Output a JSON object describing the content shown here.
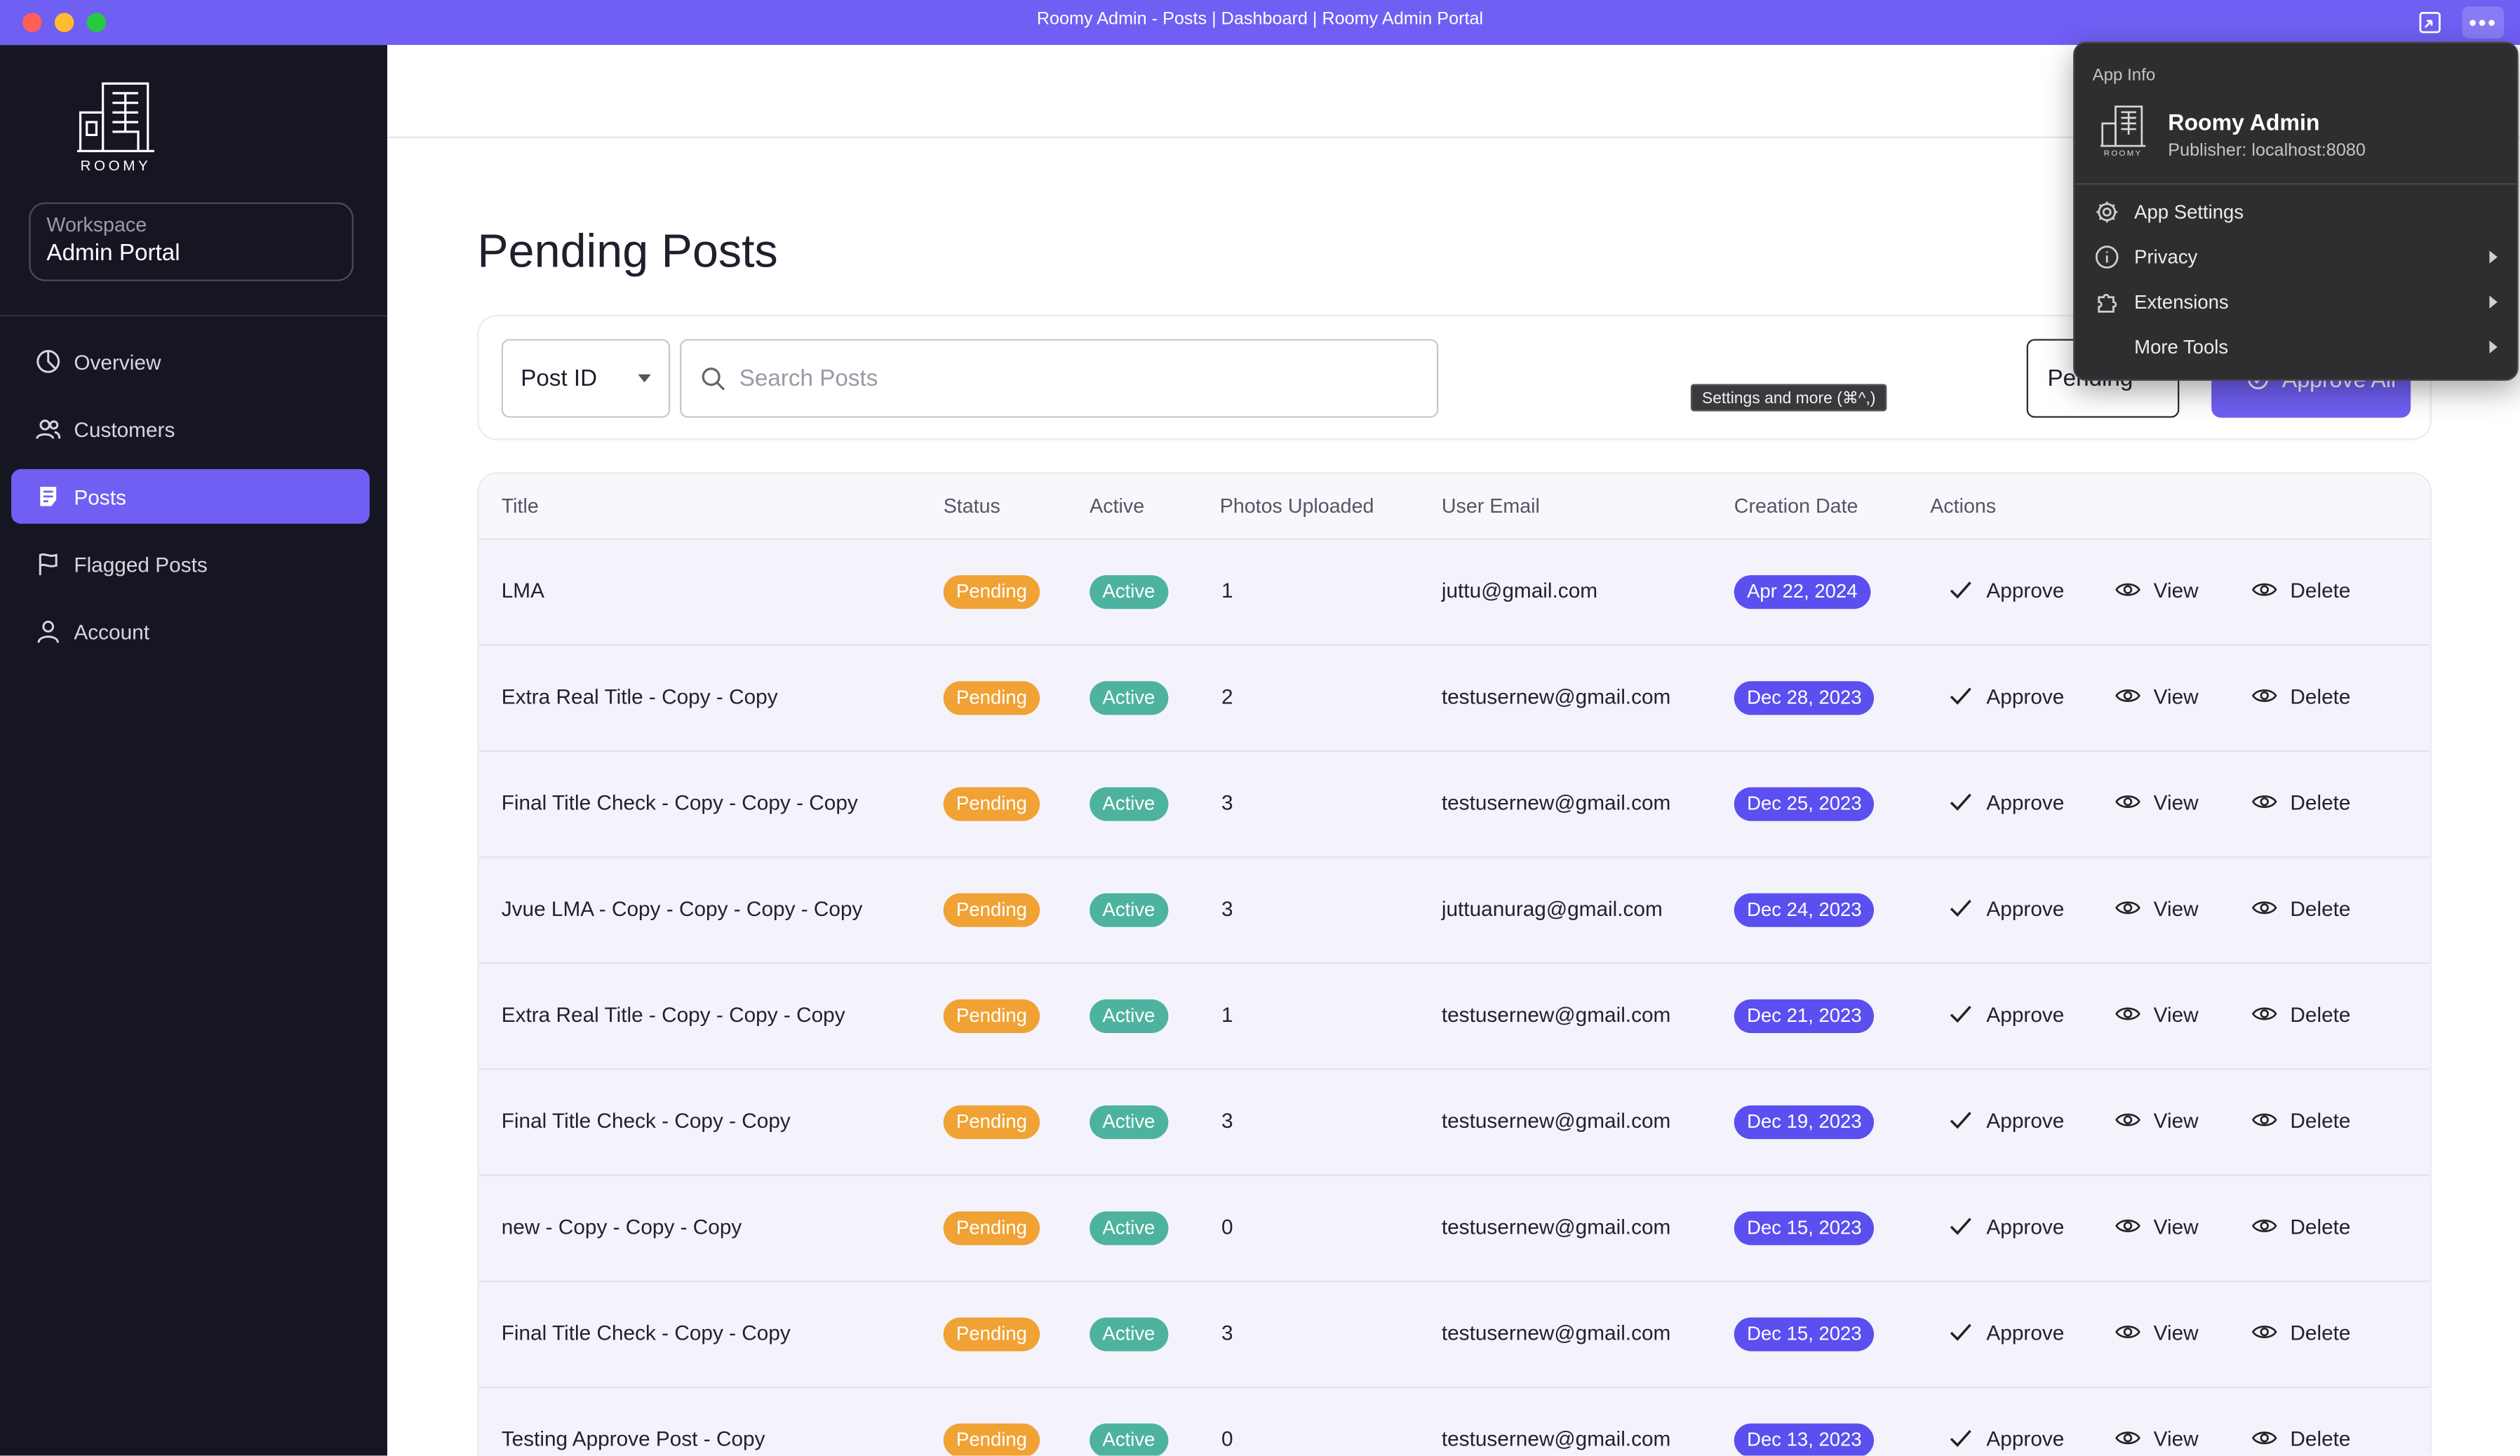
{
  "window": {
    "title": "Roomy Admin - Posts | Dashboard | Roomy Admin Portal"
  },
  "brand": {
    "logo_text": "ROOMY"
  },
  "workspace": {
    "label": "Workspace",
    "value": "Admin Portal"
  },
  "sidebar": {
    "items": [
      {
        "label": "Overview",
        "icon": "chart-pie-icon",
        "active": false
      },
      {
        "label": "Customers",
        "icon": "users-icon",
        "active": false
      },
      {
        "label": "Posts",
        "icon": "post-icon",
        "active": true
      },
      {
        "label": "Flagged Posts",
        "icon": "flag-icon",
        "active": false
      },
      {
        "label": "Account",
        "icon": "user-icon",
        "active": false
      }
    ]
  },
  "page": {
    "title": "Pending Posts"
  },
  "filters": {
    "field_select": "Post ID",
    "search_placeholder": "Search Posts",
    "status_select": "Pending",
    "approve_all": "Approve All"
  },
  "table": {
    "headers": [
      "Title",
      "Status",
      "Active",
      "Photos Uploaded",
      "User Email",
      "Creation Date",
      "Actions"
    ],
    "actions": {
      "approve": "Approve",
      "view": "View",
      "delete": "Delete"
    },
    "rows": [
      {
        "title": "LMA",
        "status": "Pending",
        "active": "Active",
        "photos": "1",
        "email": "juttu@gmail.com",
        "date": "Apr 22, 2024"
      },
      {
        "title": "Extra Real Title - Copy - Copy",
        "status": "Pending",
        "active": "Active",
        "photos": "2",
        "email": "testusernew@gmail.com",
        "date": "Dec 28, 2023"
      },
      {
        "title": "Final Title Check - Copy - Copy - Copy",
        "status": "Pending",
        "active": "Active",
        "photos": "3",
        "email": "testusernew@gmail.com",
        "date": "Dec 25, 2023"
      },
      {
        "title": "Jvue LMA - Copy - Copy - Copy - Copy",
        "status": "Pending",
        "active": "Active",
        "photos": "3",
        "email": "juttuanurag@gmail.com",
        "date": "Dec 24, 2023"
      },
      {
        "title": "Extra Real Title - Copy - Copy - Copy",
        "status": "Pending",
        "active": "Active",
        "photos": "1",
        "email": "testusernew@gmail.com",
        "date": "Dec 21, 2023"
      },
      {
        "title": "Final Title Check - Copy - Copy",
        "status": "Pending",
        "active": "Active",
        "photos": "3",
        "email": "testusernew@gmail.com",
        "date": "Dec 19, 2023"
      },
      {
        "title": "new - Copy - Copy - Copy",
        "status": "Pending",
        "active": "Active",
        "photos": "0",
        "email": "testusernew@gmail.com",
        "date": "Dec 15, 2023"
      },
      {
        "title": "Final Title Check - Copy - Copy",
        "status": "Pending",
        "active": "Active",
        "photos": "3",
        "email": "testusernew@gmail.com",
        "date": "Dec 15, 2023"
      },
      {
        "title": "Testing Approve Post - Copy",
        "status": "Pending",
        "active": "Active",
        "photos": "0",
        "email": "testusernew@gmail.com",
        "date": "Dec 13, 2023"
      }
    ]
  },
  "tooltip": {
    "text": "Settings and more (⌘^,)"
  },
  "app_menu": {
    "header": "App Info",
    "app_name": "Roomy Admin",
    "publisher": "Publisher: localhost:8080",
    "items": [
      {
        "label": "App Settings",
        "icon": "gear-icon",
        "submenu": false
      },
      {
        "label": "Privacy",
        "icon": "info-icon",
        "submenu": true
      },
      {
        "label": "Extensions",
        "icon": "puzzle-icon",
        "submenu": true
      },
      {
        "label": "More Tools",
        "icon": "",
        "submenu": true
      }
    ]
  },
  "colors": {
    "accent": "#6f5ff3",
    "sidebar_bg": "#161623",
    "pending": "#f0a234",
    "active": "#4db39e",
    "date": "#5b4ff0"
  }
}
